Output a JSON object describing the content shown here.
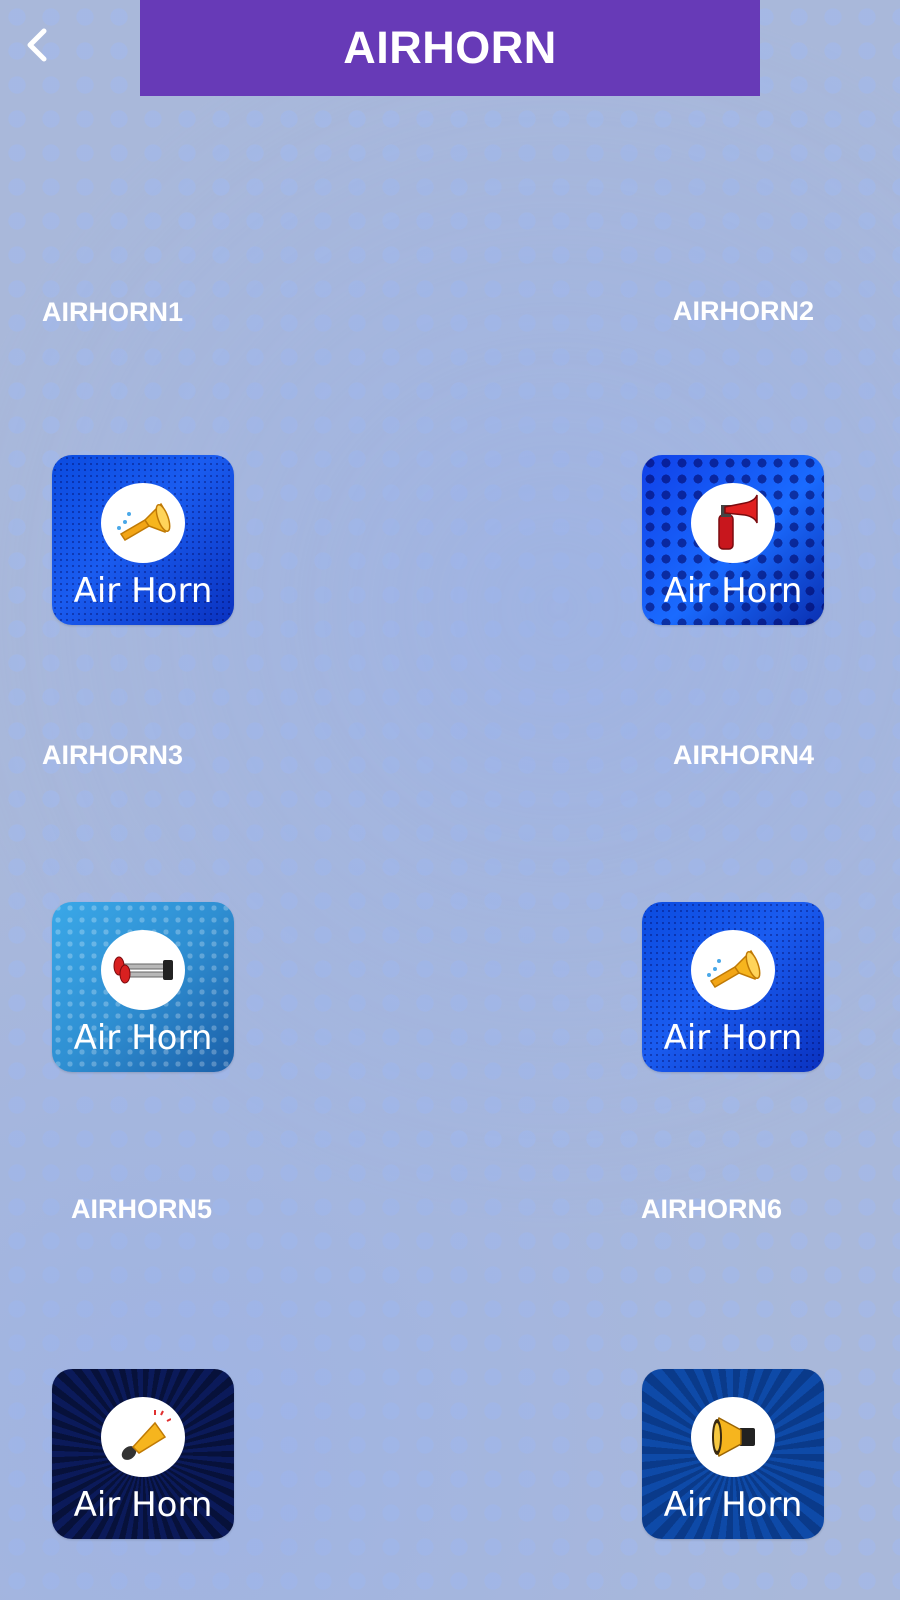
{
  "header": {
    "title": "AIRHORN",
    "back_icon": "chevron-left-icon",
    "title_bar_color": "#673ab7"
  },
  "background_color": "#a9b8da",
  "sounds": [
    {
      "label": "AIRHORN1",
      "tile_text": "Air Horn",
      "icon": "trumpet-horn-icon",
      "style": "blue1"
    },
    {
      "label": "AIRHORN2",
      "tile_text": "Air Horn",
      "icon": "red-air-horn-icon",
      "style": "blue2"
    },
    {
      "label": "AIRHORN3",
      "tile_text": "Air Horn",
      "icon": "twin-truck-horn-icon",
      "style": "cyan"
    },
    {
      "label": "AIRHORN4",
      "tile_text": "Air Horn",
      "icon": "trumpet-horn-icon",
      "style": "blue1"
    },
    {
      "label": "AIRHORN5",
      "tile_text": "Air Horn",
      "icon": "megaphone-horn-icon",
      "style": "dark"
    },
    {
      "label": "AIRHORN6",
      "tile_text": "Air Horn",
      "icon": "loudspeaker-icon",
      "style": "navy"
    }
  ]
}
